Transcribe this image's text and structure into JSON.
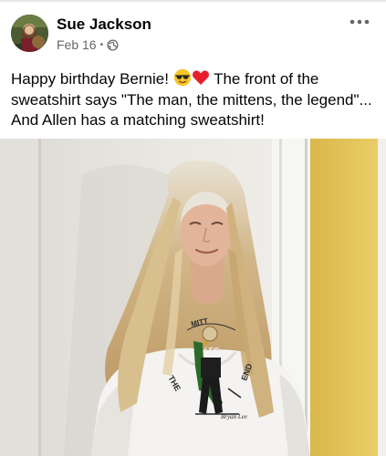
{
  "post": {
    "author": "Sue Jackson",
    "date": "Feb 16",
    "separator": "•",
    "text_part1": "Happy birthday Bernie! ",
    "text_part2": " The front of the sweatshirt says \"The man, the mittens, the legend\"... And Allen has a matching sweatshirt!",
    "emojis": [
      "sunglasses-emoji",
      "red-heart-emoji"
    ],
    "privacy_icon": "globe-icon",
    "menu_icon": "more-options-icon"
  },
  "photo": {
    "sweatshirt_print_top": "MITT",
    "sweatshirt_print_left": "THE",
    "sweatshirt_print_right": "END",
    "sweatshirt_center": "LEG",
    "signature": "Bryan Lee"
  },
  "colors": {
    "name": "#050505",
    "meta": "#65676b",
    "wall": "#e8e6e1",
    "yellow_wall": "#e6c657",
    "hair": "#c9ad7a",
    "sweatshirt": "#f4f3f1"
  }
}
